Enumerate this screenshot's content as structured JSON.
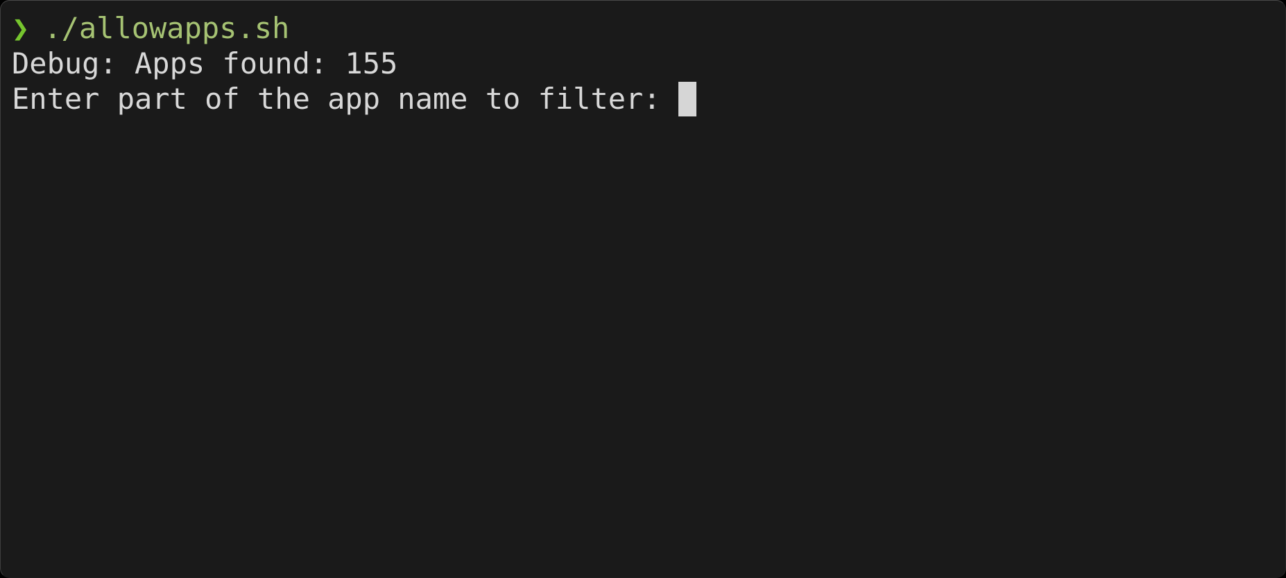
{
  "terminal": {
    "window_title": "",
    "background_color": "#1A1A1A",
    "foreground_color": "#D8D8D8",
    "prompt_color": "#76C52E",
    "command_color": "#A6C373",
    "cursor_color": "#D6D6D6",
    "lines": [
      {
        "type": "command",
        "prompt": "❯",
        "text": "./allowapps.sh"
      },
      {
        "type": "output",
        "text": "Debug: Apps found: 155"
      },
      {
        "type": "input-prompt",
        "text": "Enter part of the app name to filter: ",
        "input_value": ""
      }
    ]
  }
}
